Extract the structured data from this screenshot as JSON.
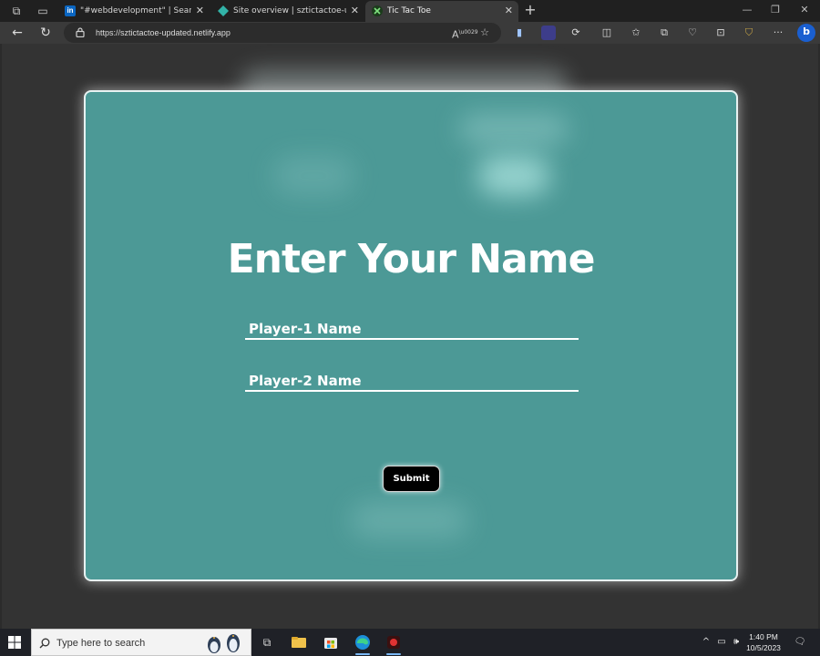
{
  "browser": {
    "tabs": [
      {
        "title": "\"#webdevelopment\" | Search | Li",
        "favicon": "in",
        "active": false
      },
      {
        "title": "Site overview | sztictactoe-updat",
        "favicon": "netlify-diamond",
        "active": false
      },
      {
        "title": "Tic Tac Toe",
        "favicon": "tictactoe",
        "active": true
      }
    ],
    "url": "https://sztictactoe-updated.netlify.app",
    "window_controls": {
      "minimize": "—",
      "restore": "❐",
      "close": "✕"
    }
  },
  "page": {
    "heading": "Enter Your Name",
    "player1_placeholder": "Player-1 Name",
    "player2_placeholder": "Player-2 Name",
    "submit_label": "Submit",
    "card_color": "#4c9996"
  },
  "taskbar": {
    "search_placeholder": "Type here to search",
    "time": "1:40 PM",
    "date": "10/5/2023"
  }
}
